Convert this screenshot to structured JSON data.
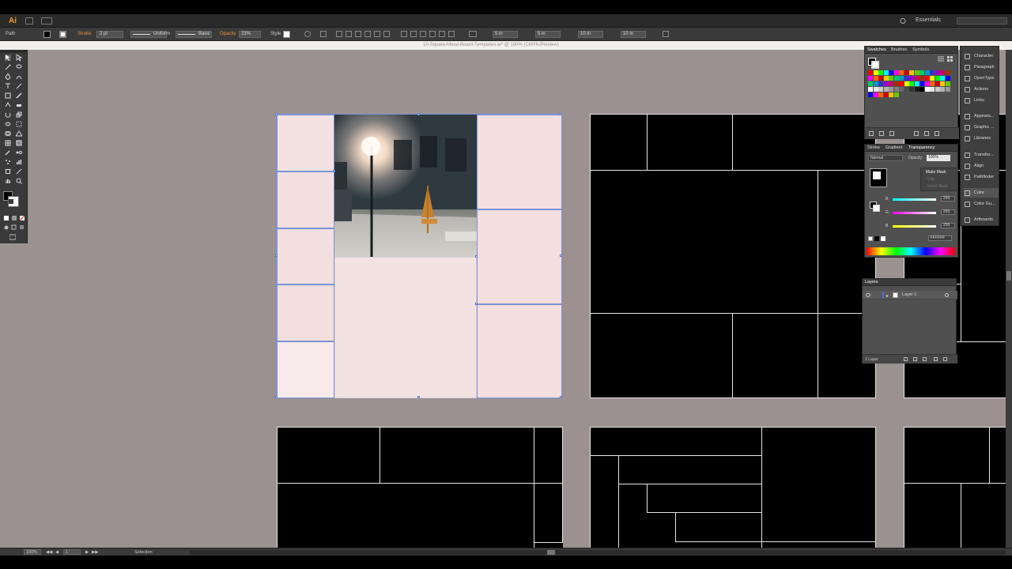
{
  "app": {
    "logo": "Ai",
    "workspace": "Essentials",
    "document_title": "10-Square-Mood-Board-Templates.ai* @ 100% (CMYK/Preview)"
  },
  "control_bar": {
    "object_type": "Path",
    "stroke_label": "Stroke",
    "stroke_weight": "2 pt",
    "stroke_profile": "Uniform",
    "brush": "Basic",
    "opacity_label": "Opacity",
    "opacity_value": "23%",
    "style_label": "Style",
    "w_value": "5 in",
    "h_value": "5 in",
    "x_value": "10 in",
    "y_value": "10 in"
  },
  "swatches_panel": {
    "tabs": [
      "Swatches",
      "Brushes",
      "Symbols"
    ],
    "colors": [
      "#ff0000",
      "#ffff00",
      "#00ff00",
      "#00ffff",
      "#0000ff",
      "#ff00ff",
      "#ff6600",
      "#cc0000",
      "#ffcc00",
      "#66cc00",
      "#00cc66",
      "#0099cc",
      "#3333cc",
      "#9900cc",
      "#cc0066",
      "#993300"
    ]
  },
  "transparency_panel": {
    "tabs": [
      "Stroke",
      "Gradient",
      "Transparency"
    ],
    "blend_mode": "Normal",
    "opacity_label": "Opacity:",
    "opacity_value": "100%",
    "make_mask": "Make Mask",
    "clip": "Clip",
    "invert_mask": "Invert Mask",
    "r_label": "R",
    "g_label": "G",
    "b_label": "B",
    "r_value": "255",
    "g_value": "255",
    "b_value": "255",
    "hex_value": "FFFFFF"
  },
  "layers_panel": {
    "tab": "Layers",
    "layer_name": "Layer 1",
    "footer": "1 Layer"
  },
  "dock": {
    "items": [
      "Character",
      "Paragraph",
      "OpenType",
      "Actions",
      "Links",
      "Appeara...",
      "Graphic ...",
      "Libraries",
      "Transfor...",
      "Align",
      "Pathfinder",
      "Color",
      "Color Gu...",
      "Artboards"
    ]
  },
  "status_bar": {
    "zoom": "100%",
    "artboard_num": "1",
    "tool_name": "Selection"
  }
}
